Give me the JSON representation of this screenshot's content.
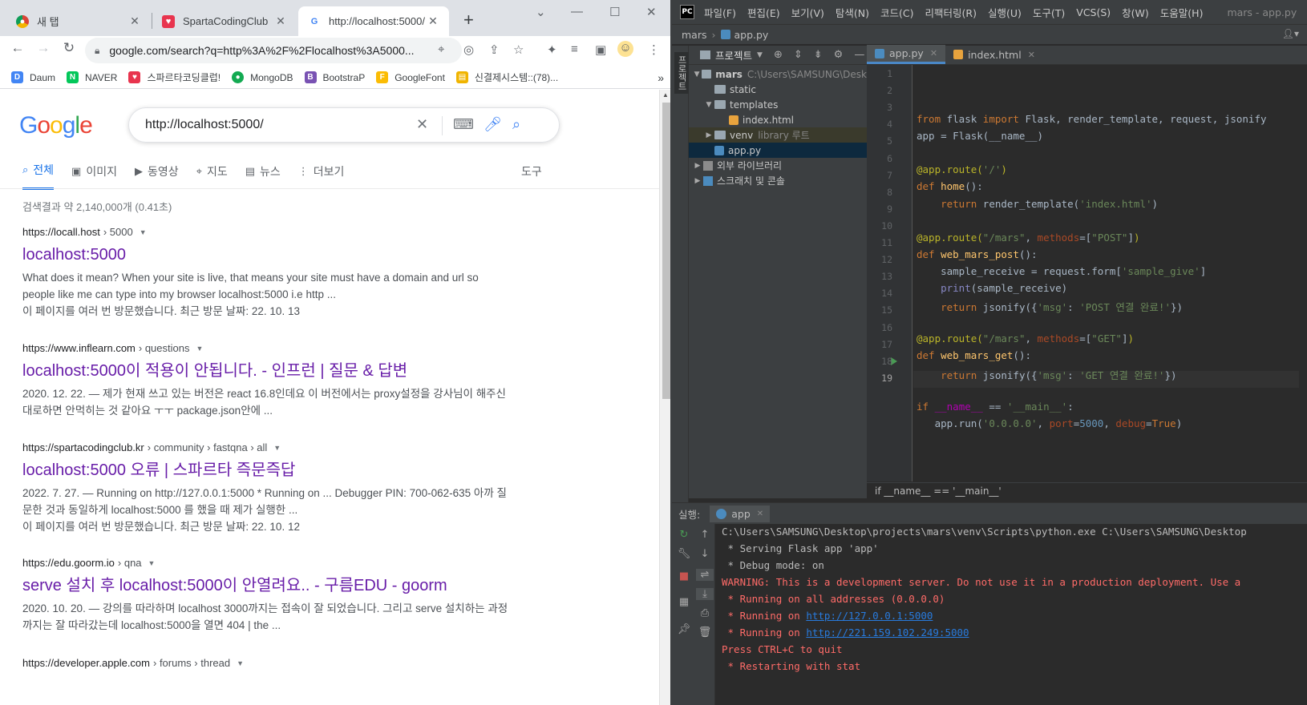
{
  "browser": {
    "tabs": [
      {
        "title": "새 탭",
        "favicon": "chrome-icon"
      },
      {
        "title": "SpartaCodingClub",
        "favicon": "sparta-icon"
      },
      {
        "title": "http://localhost:5000/",
        "favicon": "google-icon"
      }
    ],
    "address": "google.com/search?q=http%3A%2F%2Flocalhost%3A5000...",
    "bookmarks": [
      {
        "label": "Daum",
        "color": "#4285f4"
      },
      {
        "label": "NAVER",
        "color": "#03c75a"
      },
      {
        "label": "스파르타코딩클럽!",
        "color": "#e8344e"
      },
      {
        "label": "MongoDB",
        "color": "#13aa52"
      },
      {
        "label": "BootstraP",
        "color": "#7952b3"
      },
      {
        "label": "GoogleFont",
        "color": "#fbbc04"
      },
      {
        "label": "신결제시스템::(78)...",
        "color": "#f0b400"
      }
    ]
  },
  "google": {
    "logo": "Google",
    "query": "http://localhost:5000/",
    "tabs": [
      "전체",
      "이미지",
      "동영상",
      "지도",
      "뉴스",
      "더보기"
    ],
    "tools": "도구",
    "stats": "검색결과 약 2,140,000개 (0.41초)",
    "results": [
      {
        "site": "https://locall.host",
        "path": "› 5000",
        "title": "localhost:5000",
        "snippet": "What does it mean? When your site is live, that means your site must have a domain and url so people like me can type into my browser localhost:5000 i.e http ...",
        "visited": "이 페이지를 여러 번 방문했습니다. 최근 방문 날짜: 22. 10. 13"
      },
      {
        "site": "https://www.inflearn.com",
        "path": "› questions",
        "title": "localhost:5000이 적용이 안됩니다. - 인프런 | 질문 & 답변",
        "snippet": "2020. 12. 22. — 제가 현재 쓰고 있는 버전은 react 16.8인데요 이 버전에서는 proxy설정을 강사님이 해주신대로하면 안먹히는 것 같아요 ㅜㅜ package.json안에 ...",
        "visited": ""
      },
      {
        "site": "https://spartacodingclub.kr",
        "path": "› community › fastqna › all",
        "title": "localhost:5000 오류 | 스파르타 즉문즉답",
        "snippet": "2022. 7. 27. — Running on http://127.0.0.1:5000 * Running on ... Debugger PIN: 700-062-635 아까 질문한 것과 동일하게 localhost:5000 를 했을 때 제가 실행한 ...",
        "visited": "이 페이지를 여러 번 방문했습니다. 최근 방문 날짜: 22. 10. 12"
      },
      {
        "site": "https://edu.goorm.io",
        "path": "› qna",
        "title": "serve 설치 후 localhost:5000이 안열려요.. - 구름EDU - goorm",
        "snippet": "2020. 10. 20. — 강의를 따라하며 localhost 3000까지는 접속이 잘 되었습니다. 그리고 serve 설치하는 과정까지는 잘 따라갔는데 localhost:5000을 열면 404 | the ...",
        "visited": ""
      },
      {
        "site": "https://developer.apple.com",
        "path": "› forums › thread",
        "title": "",
        "snippet": "",
        "visited": ""
      }
    ]
  },
  "ide": {
    "logo": "PC",
    "menus": [
      "파일(F)",
      "편집(E)",
      "보기(V)",
      "탐색(N)",
      "코드(C)",
      "리팩터링(R)",
      "실행(U)",
      "도구(T)",
      "VCS(S)",
      "창(W)",
      "도움말(H)"
    ],
    "window_title": "mars - app.py",
    "breadcrumb": [
      "mars",
      "app.py"
    ],
    "side_tab": "프로젝트",
    "project_header": "프로젝트",
    "tree": [
      {
        "label": "mars",
        "dim": "C:\\Users\\SAMSUNG\\Desk"
      },
      {
        "label": "static",
        "dim": ""
      },
      {
        "label": "templates",
        "dim": ""
      },
      {
        "label": "index.html",
        "dim": ""
      },
      {
        "label": "venv",
        "dim": "library 루트"
      },
      {
        "label": "app.py",
        "dim": ""
      },
      {
        "label": "외부 라이브러리",
        "dim": ""
      },
      {
        "label": "스크래치 및 콘솔",
        "dim": ""
      }
    ],
    "editor_tabs": [
      "app.py",
      "index.html"
    ],
    "line_numbers": [
      "1",
      "2",
      "3",
      "4",
      "5",
      "6",
      "7",
      "8",
      "9",
      "10",
      "11",
      "12",
      "13",
      "14",
      "15",
      "16",
      "17",
      "18",
      "19"
    ],
    "code_breadcrumb": "if __name__ == '__main__'",
    "run_label": "실행:",
    "run_tab": "app",
    "console": [
      "C:\\Users\\SAMSUNG\\Desktop\\projects\\mars\\venv\\Scripts\\python.exe C:\\Users\\SAMSUNG\\Desktop",
      " * Serving Flask app 'app'",
      " * Debug mode: on",
      "WARNING: This is a development server. Do not use it in a production deployment. Use a",
      " * Running on all addresses (0.0.0.0)",
      " * Running on ",
      "http://127.0.0.1:5000",
      " * Running on ",
      "http://221.159.102.249:5000",
      "Press CTRL+C to quit",
      " * Restarting with stat"
    ]
  }
}
